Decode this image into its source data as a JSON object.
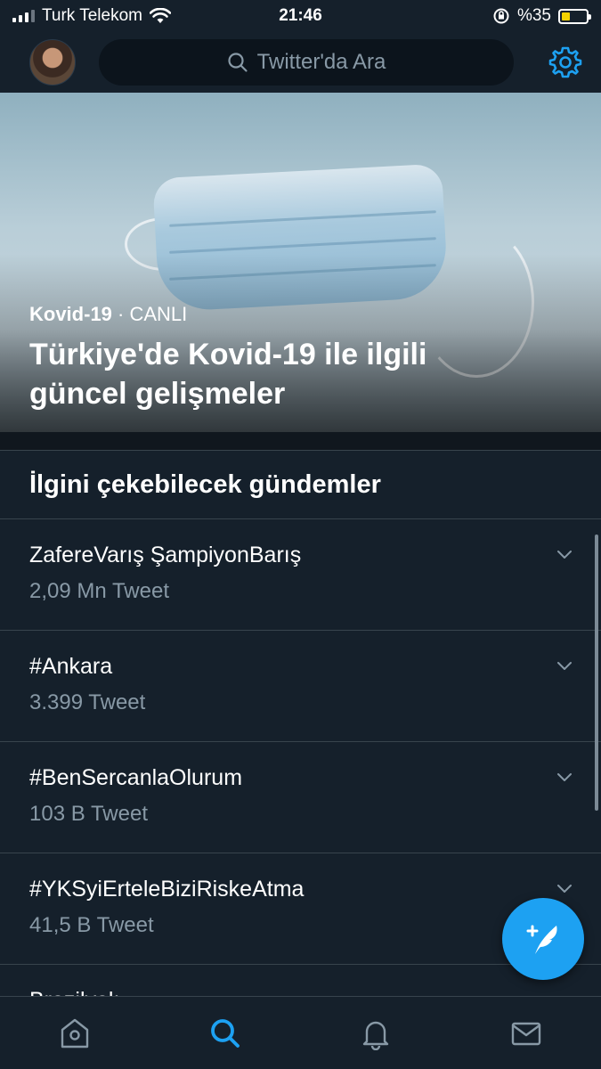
{
  "status_bar": {
    "carrier": "Turk Telekom",
    "time": "21:46",
    "battery_text": "%35",
    "battery_level": 0.35,
    "battery_color": "#f5d300"
  },
  "header": {
    "search_placeholder": "Twitter'da Ara",
    "icons": [
      "avatar",
      "search-icon",
      "settings-gear-icon"
    ]
  },
  "hero": {
    "topic": "Kovid-19",
    "separator": " · ",
    "live_label": "CANLI",
    "title": "Türkiye'de Kovid-19 ile ilgili güncel gelişmeler"
  },
  "trends": {
    "section_title": "İlgini çekebilecek gündemler",
    "items": [
      {
        "name": "ZafereVarış ŞampiyonBarış",
        "count": "2,09 Mn Tweet"
      },
      {
        "name": "#Ankara",
        "count": "3.399 Tweet"
      },
      {
        "name": "#BenSercanlaOlurum",
        "count": "103 B Tweet"
      },
      {
        "name": "#YKSyiErteleBiziRiskeAtma",
        "count": "41,5 B Tweet"
      },
      {
        "name": "Brezilyalı",
        "count": ""
      }
    ]
  },
  "colors": {
    "background": "#15202b",
    "accent": "#1da1f2",
    "secondary_text": "#8899a6",
    "divider": "#38444d"
  },
  "tab_bar": {
    "tabs": [
      {
        "name": "home",
        "icon": "home-icon",
        "active": false
      },
      {
        "name": "explore",
        "icon": "search-icon",
        "active": true
      },
      {
        "name": "notifications",
        "icon": "bell-icon",
        "active": false
      },
      {
        "name": "messages",
        "icon": "mail-icon",
        "active": false
      }
    ]
  }
}
